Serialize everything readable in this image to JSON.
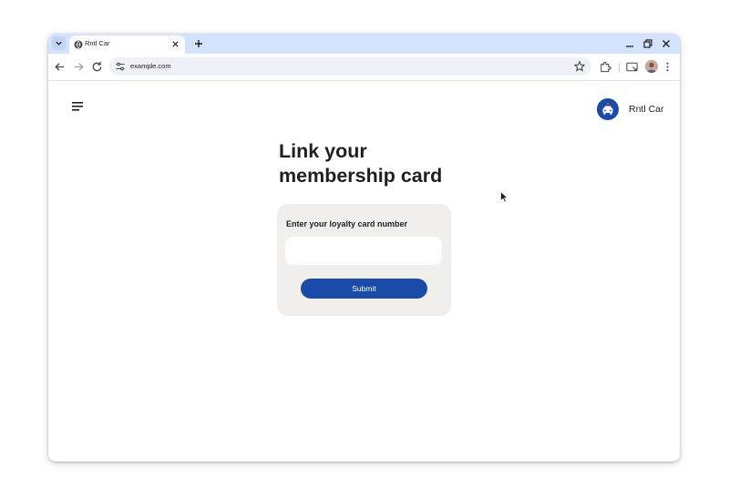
{
  "browser": {
    "tab": {
      "title": "Rntl Car"
    },
    "url": "example.com"
  },
  "page": {
    "brand_name": "Rntl Car",
    "heading_line1": "Link your",
    "heading_line2": "membership card",
    "form": {
      "label": "Enter your loyalty card number",
      "input_value": "",
      "input_placeholder": "",
      "submit_label": "Submit"
    }
  },
  "icons": {
    "tab_menu": "chevron-down-icon",
    "favicon": "globe-icon",
    "tab_close": "close-icon",
    "new_tab": "plus-icon",
    "minimize": "minimize-icon",
    "restore": "restore-icon",
    "close": "close-window-icon",
    "back": "arrow-left-icon",
    "forward": "arrow-right-icon",
    "reload": "reload-icon",
    "site_info": "tune-icon",
    "bookmark": "star-icon",
    "extensions": "puzzle-icon",
    "cast": "cast-icon",
    "profile": "avatar",
    "menu": "more-vert-icon",
    "hamburger": "hamburger-menu-icon",
    "brand_logo": "car-icon"
  },
  "colors": {
    "tabstrip": "#d3e3fd",
    "accent": "#1a4ba8",
    "card_bg": "#f0efeb",
    "brand_logo_bg": "#1a4ba8"
  }
}
